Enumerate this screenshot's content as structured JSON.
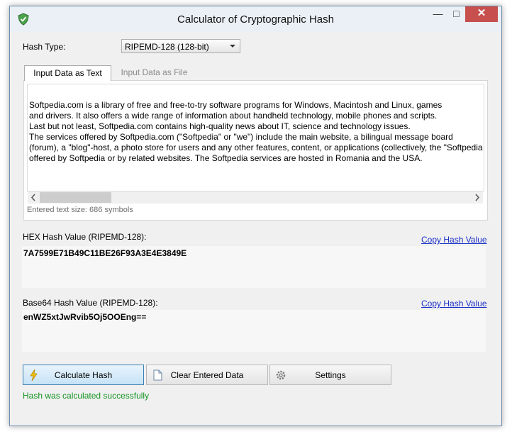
{
  "window": {
    "title": "Calculator of Cryptographic Hash",
    "controls": {
      "minimize": "—",
      "maximize": "□",
      "close": "✕"
    }
  },
  "hash_type": {
    "label": "Hash Type:",
    "selected": "RIPEMD-128 (128-bit)"
  },
  "tabs": [
    {
      "label": "Input Data as Text",
      "active": true
    },
    {
      "label": "Input Data as File",
      "active": false
    }
  ],
  "input": {
    "lines": [
      "Softpedia.com is a library of free and free-to-try software programs for Windows, Macintosh and Linux, games",
      "and drivers. It also offers a wide range of information about handheld technology, mobile phones and scripts.",
      "Last but not least, Softpedia.com contains high-quality news about IT, science and technology issues.",
      "The services offered by Softpedia.com (\"Softpedia\" or \"we\") include the main website, a bilingual message board",
      " (forum), a \"blog\"-host, a photo store for users and any other features, content, or applications (collectively, the \"Softpedia",
      "offered by Softpedia or by related websites. The Softpedia services are hosted in Romania and the USA."
    ],
    "text_size": "Entered text size: 686 symbols"
  },
  "hex": {
    "label": "HEX Hash Value (RIPEMD-128):",
    "copy_label": "Copy Hash Value",
    "value": "7A7599E71B49C11BE26F93A3E4E3849E"
  },
  "base64": {
    "label": "Base64 Hash Value (RIPEMD-128):",
    "copy_label": "Copy Hash Value",
    "value": "enWZ5xtJwRvib5Oj5OOEng=="
  },
  "buttons": {
    "calculate": "Calculate Hash",
    "clear": "Clear Entered Data",
    "settings": "Settings"
  },
  "status": "Hash was calculated successfully",
  "colors": {
    "link": "#1a30c8",
    "success": "#169423",
    "close_button": "#c7504f",
    "accent": "#3c7fb1"
  },
  "icons": {
    "app": "shield-check-icon",
    "calculate": "lightning-icon",
    "clear": "document-icon",
    "settings": "gear-icon"
  }
}
